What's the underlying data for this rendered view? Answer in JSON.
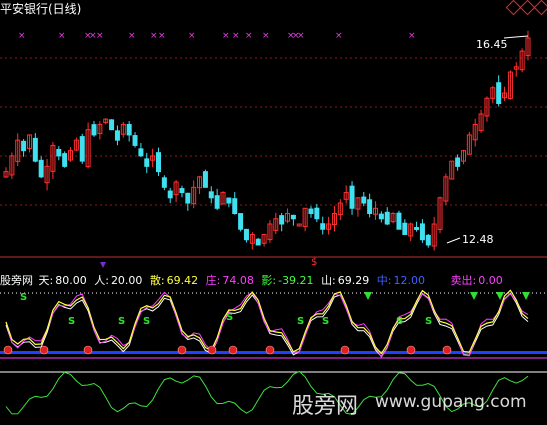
{
  "header": {
    "title": "平安银行(日线)"
  },
  "price_labels": {
    "high": "16.45",
    "low": "12.48"
  },
  "marker_text": "$",
  "indicator": {
    "name": "股旁网",
    "items": [
      {
        "label": "天:",
        "value": "80.00",
        "color": "#ffffff"
      },
      {
        "label": "人:",
        "value": "20.00",
        "color": "#ffffff"
      },
      {
        "label": "散:",
        "value": "69.42",
        "color": "#ffff40"
      },
      {
        "label": "庄:",
        "value": "74.08",
        "color": "#ff40ff"
      },
      {
        "label": "影:",
        "value": "-39.21",
        "color": "#40ff40"
      },
      {
        "label": "山:",
        "value": "69.29",
        "color": "#ffffff"
      },
      {
        "label": "中:",
        "value": "12.00",
        "color": "#4060ff"
      },
      {
        "label": "卖出:",
        "value": "0.00",
        "color": "#ff40ff"
      }
    ]
  },
  "watermark": {
    "cn": "股旁网",
    "url": "www.gupang.com"
  },
  "chart_data": {
    "type": "candlestick",
    "high_marker": 16.45,
    "low_marker": 12.48,
    "ohlc_close_path": [
      13.9,
      14.2,
      14.5,
      14.3,
      14.6,
      14.1,
      13.8,
      14.0,
      14.4,
      14.2,
      14.0,
      14.3,
      14.5,
      14.1,
      14.7,
      14.6,
      14.8,
      14.9,
      14.7,
      14.5,
      14.8,
      14.6,
      14.4,
      14.2,
      14.0,
      14.2,
      13.9,
      13.6,
      13.4,
      13.7,
      13.5,
      13.3,
      13.6,
      13.8,
      13.6,
      13.4,
      13.2,
      13.5,
      13.3,
      13.1,
      12.8,
      12.6,
      12.7,
      12.5,
      12.7,
      12.9,
      13.0,
      12.9,
      13.1,
      13.0,
      12.9,
      13.2,
      13.1,
      13.0,
      12.8,
      12.9,
      13.1,
      13.3,
      13.5,
      13.2,
      13.4,
      13.3,
      13.1,
      13.2,
      13.0,
      12.9,
      13.1,
      12.8,
      12.7,
      12.9,
      12.8,
      12.6,
      12.5,
      12.9,
      13.4,
      13.8,
      14.1,
      14.0,
      14.3,
      14.6,
      14.8,
      15.0,
      15.3,
      15.5,
      15.2,
      15.4,
      15.8,
      15.9,
      16.2,
      16.45
    ]
  }
}
